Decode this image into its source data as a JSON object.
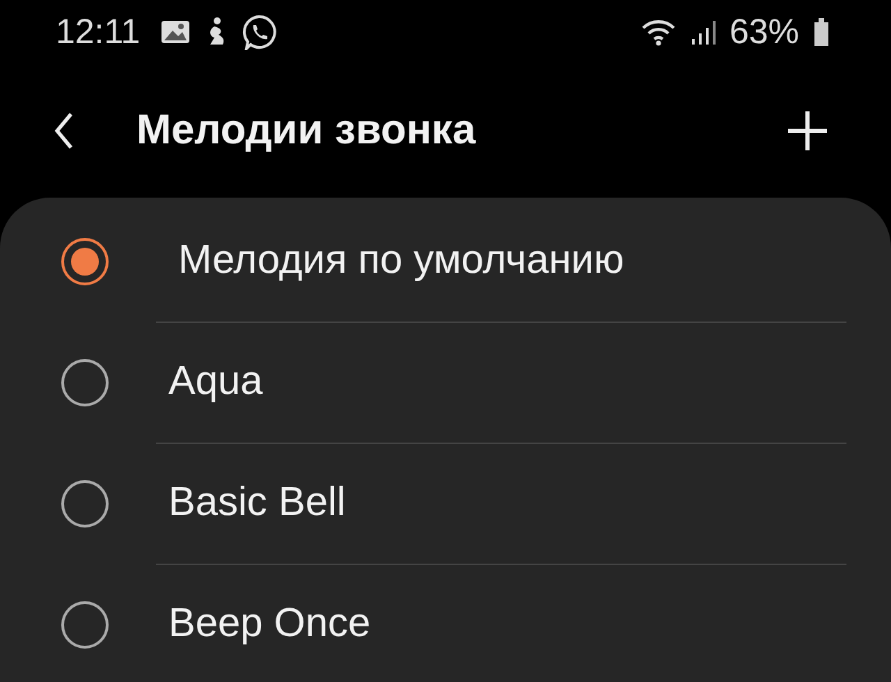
{
  "status_bar": {
    "time": "12:11",
    "battery": "63%"
  },
  "header": {
    "title": "Мелодии звонка"
  },
  "ringtones": [
    {
      "label": "Мелодия по умолчанию",
      "selected": true
    },
    {
      "label": "Aqua",
      "selected": false
    },
    {
      "label": "Basic Bell",
      "selected": false
    },
    {
      "label": "Beep Once",
      "selected": false
    }
  ]
}
